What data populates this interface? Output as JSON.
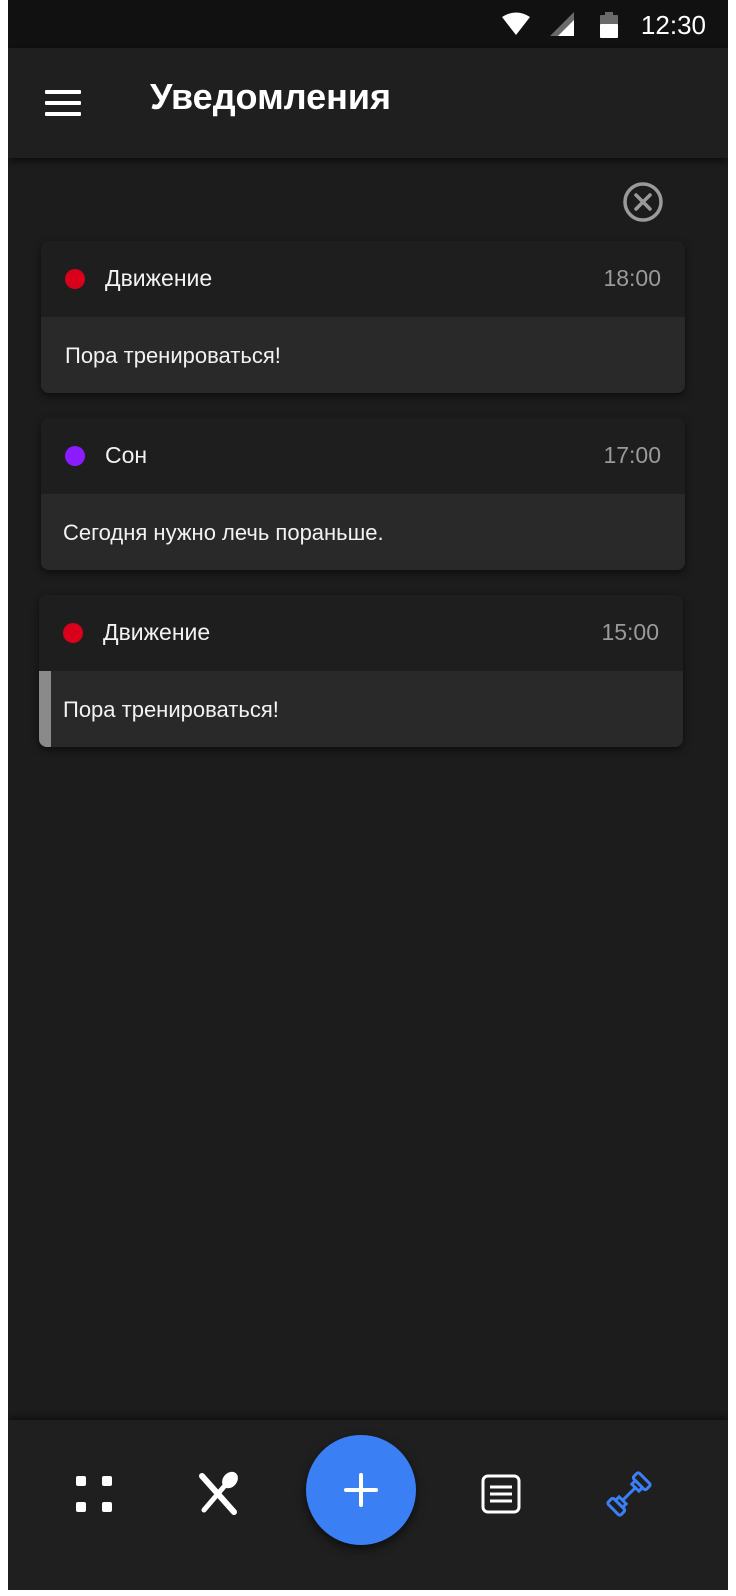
{
  "status_bar": {
    "time": "12:30",
    "icons": [
      "wifi-icon",
      "signal-icon",
      "battery-icon"
    ]
  },
  "app_bar": {
    "title": "Уведомления",
    "menu_icon": "hamburger-menu-icon"
  },
  "clear_all_icon": "close-circle-icon",
  "notifications": [
    {
      "category": "Движение",
      "time": "18:00",
      "message": "Пора тренироваться!",
      "dot_color": "#d9001b"
    },
    {
      "category": "Сон",
      "time": "17:00",
      "message": "Сегодня нужно лечь пораньше.",
      "dot_color": "#8a1cff"
    },
    {
      "category": "Движение",
      "time": "15:00",
      "message": "Пора тренироваться!",
      "dot_color": "#d9001b"
    }
  ],
  "bottom_nav": {
    "items": [
      "grid-icon",
      "fork-spoon-icon",
      "add-icon",
      "list-icon",
      "dumbbell-icon"
    ],
    "active": "dumbbell-icon",
    "fab_color": "#3b7ff5",
    "active_color": "#3b7ff5"
  },
  "colors": {
    "background": "#1c1c1c",
    "card_header": "#1e1e1e",
    "card_body": "#292929"
  }
}
